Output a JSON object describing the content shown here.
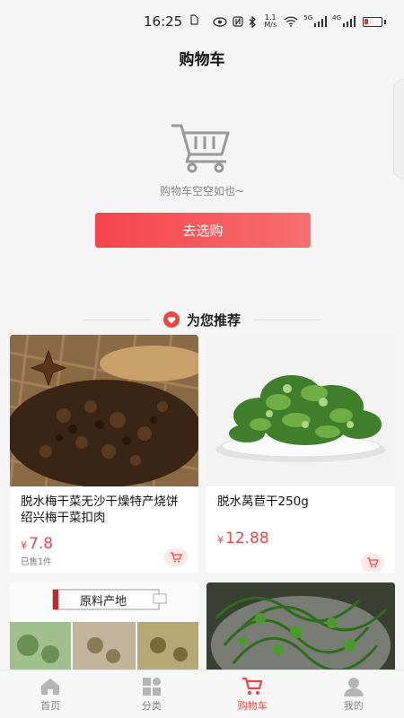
{
  "status_bar": {
    "time": "16:25",
    "network_speed": "1.1 M/s",
    "signal_1_label": "5G",
    "signal_2_label": "4G"
  },
  "header": {
    "title": "购物车"
  },
  "cart": {
    "empty_text": "购物车空空如也~",
    "go_shop_label": "去选购"
  },
  "recommend": {
    "title": "为您推荐",
    "products": [
      {
        "name": "脱水梅干菜无沙干燥特产烧饼绍兴梅干菜扣肉",
        "currency": "¥",
        "price": "7.8",
        "sold": "已售1件"
      },
      {
        "name": "脱水莴苣干250g",
        "currency": "¥",
        "price": "12.88",
        "sold": ""
      },
      {
        "name": "",
        "banner_text": "原料产地",
        "currency": "",
        "price": "",
        "sold": ""
      },
      {
        "name": "",
        "currency": "",
        "price": "",
        "sold": ""
      }
    ]
  },
  "bottom_nav": {
    "items": [
      {
        "label": "首页",
        "icon": "home-icon"
      },
      {
        "label": "分类",
        "icon": "category-icon"
      },
      {
        "label": "购物车",
        "icon": "cart-icon"
      },
      {
        "label": "我的",
        "icon": "user-icon"
      }
    ],
    "active_index": 2
  },
  "colors": {
    "accent": "#ef4444",
    "button_gradient_start": "#f6454a",
    "button_gradient_end": "#f76e6e"
  }
}
